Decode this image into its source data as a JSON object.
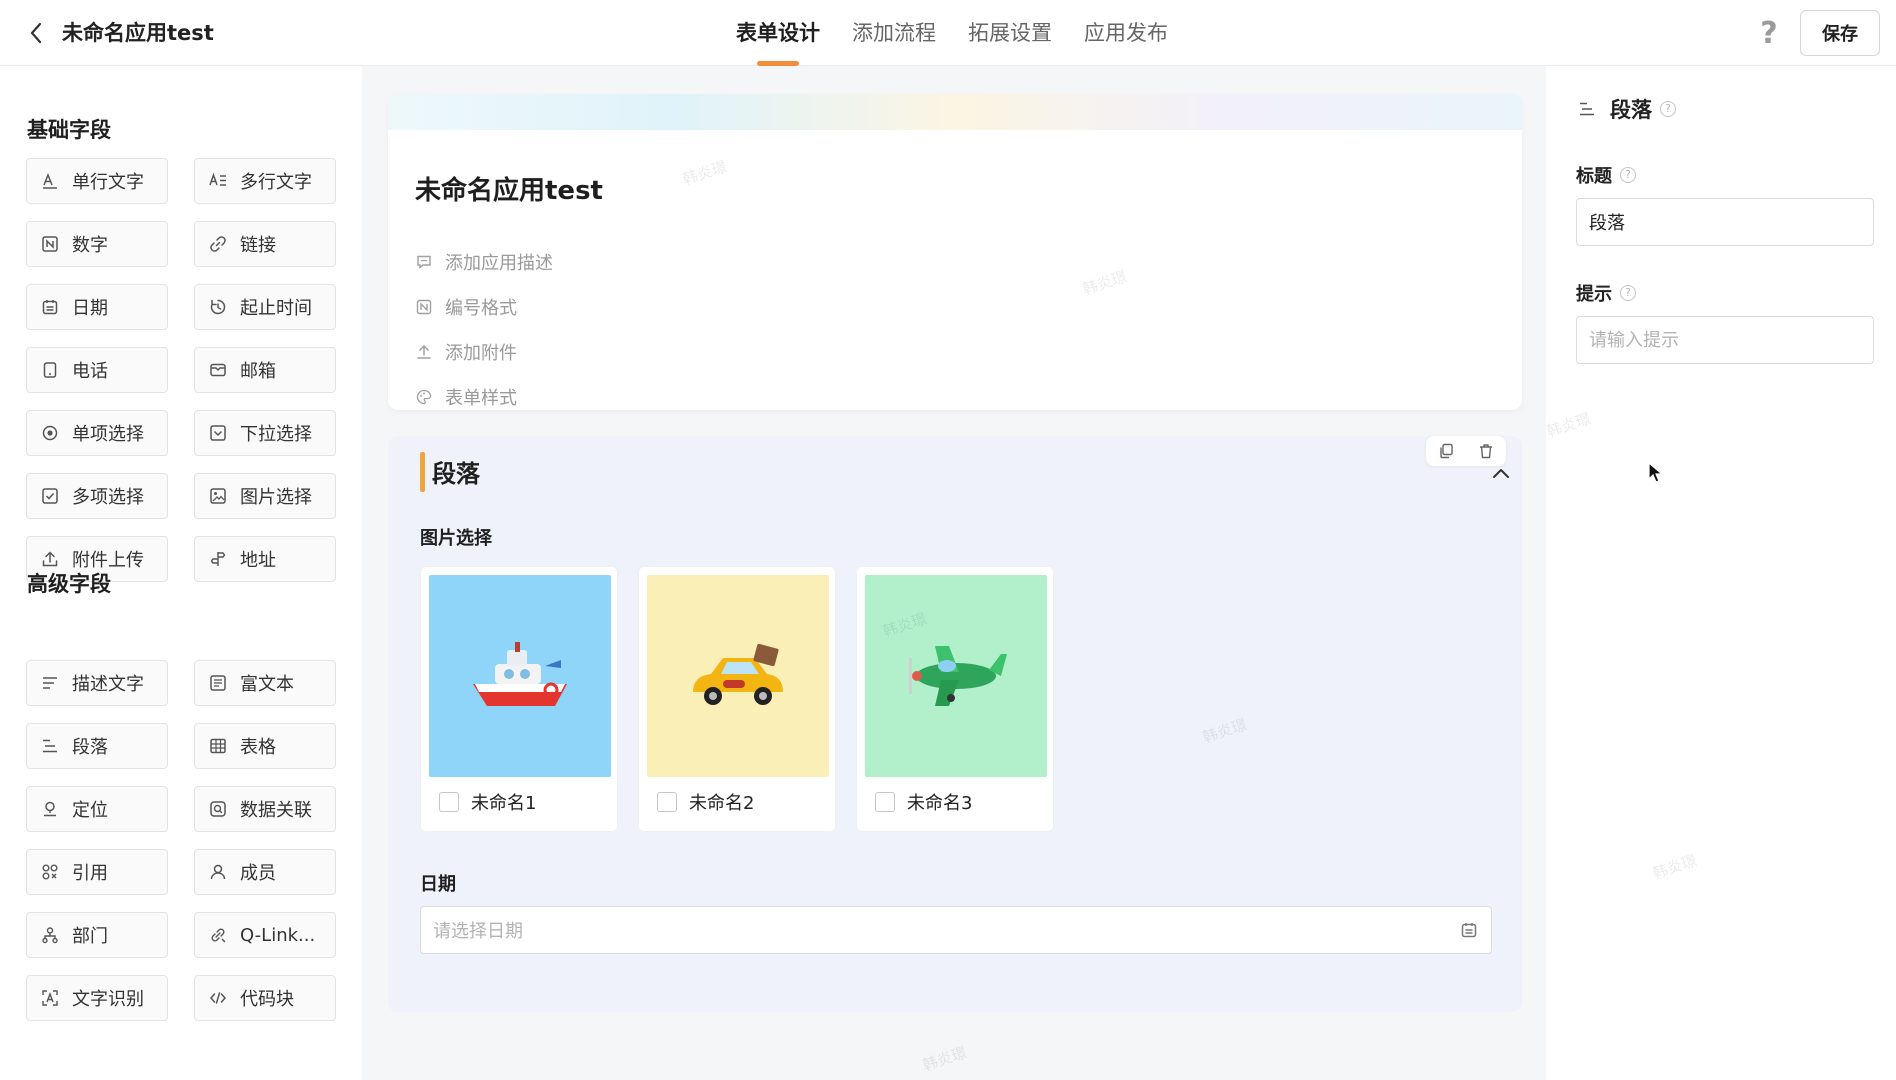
{
  "header": {
    "app_title": "未命名应用test",
    "tabs": [
      "表单设计",
      "添加流程",
      "拓展设置",
      "应用发布"
    ],
    "help_label": "?",
    "save_label": "保存"
  },
  "left_panel": {
    "basic_title": "基础字段",
    "basic_fields": [
      {
        "label": "单行文字",
        "icon": "single-line-text-icon"
      },
      {
        "label": "多行文字",
        "icon": "multi-line-text-icon"
      },
      {
        "label": "数字",
        "icon": "number-icon"
      },
      {
        "label": "链接",
        "icon": "link-icon"
      },
      {
        "label": "日期",
        "icon": "calendar-icon"
      },
      {
        "label": "起止时间",
        "icon": "time-range-icon"
      },
      {
        "label": "电话",
        "icon": "phone-icon"
      },
      {
        "label": "邮箱",
        "icon": "mail-icon"
      },
      {
        "label": "单项选择",
        "icon": "radio-icon"
      },
      {
        "label": "下拉选择",
        "icon": "dropdown-icon"
      },
      {
        "label": "多项选择",
        "icon": "checkbox-icon"
      },
      {
        "label": "图片选择",
        "icon": "image-icon"
      },
      {
        "label": "附件上传",
        "icon": "upload-icon"
      },
      {
        "label": "地址",
        "icon": "address-icon"
      }
    ],
    "advanced_title": "高级字段",
    "advanced_fields": [
      {
        "label": "描述文字",
        "icon": "description-icon"
      },
      {
        "label": "富文本",
        "icon": "rich-text-icon"
      },
      {
        "label": "段落",
        "icon": "paragraph-icon"
      },
      {
        "label": "表格",
        "icon": "table-icon"
      },
      {
        "label": "定位",
        "icon": "location-icon"
      },
      {
        "label": "数据关联",
        "icon": "data-link-icon"
      },
      {
        "label": "引用",
        "icon": "reference-icon"
      },
      {
        "label": "成员",
        "icon": "member-icon"
      },
      {
        "label": "部门",
        "icon": "department-icon"
      },
      {
        "label": "Q-Link...",
        "icon": "qlink-icon"
      },
      {
        "label": "文字识别",
        "icon": "ocr-icon"
      },
      {
        "label": "代码块",
        "icon": "code-icon"
      }
    ]
  },
  "form": {
    "title": "未命名应用test",
    "meta": [
      "添加应用描述",
      "编号格式",
      "添加附件",
      "表单样式"
    ],
    "paragraph_title": "段落",
    "image_field_label": "图片选择",
    "image_options": [
      {
        "name": "未命名1",
        "color": "#8fd5f9"
      },
      {
        "name": "未命名2",
        "color": "#fbefb8"
      },
      {
        "name": "未命名3",
        "color": "#b2f0cc"
      }
    ],
    "date_field_label": "日期",
    "date_placeholder": "请选择日期",
    "watermark": "韩炎璟"
  },
  "right_panel": {
    "title": "段落",
    "title_label": "标题",
    "title_value": "段落",
    "hint_label": "提示",
    "hint_placeholder": "请输入提示"
  }
}
